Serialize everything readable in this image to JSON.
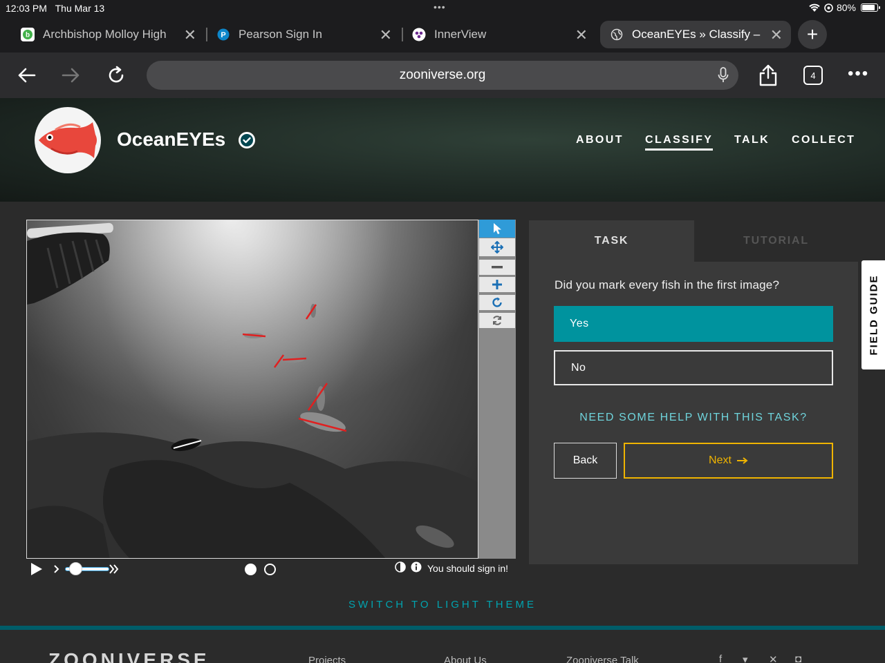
{
  "status": {
    "time": "12:03 PM",
    "date": "Thu Mar 13",
    "dots": "•••",
    "battery": "80%",
    "battery_level": 0.8
  },
  "tabs": [
    {
      "title": "Archbishop Molloy High",
      "favicon": "bb-icon",
      "active": false
    },
    {
      "title": "Pearson Sign In",
      "favicon": "pearson-icon",
      "active": false
    },
    {
      "title": "InnerView",
      "favicon": "innerview-icon",
      "active": false
    },
    {
      "title": "OceanEYEs » Classify –",
      "favicon": "globe-icon",
      "active": true
    }
  ],
  "toolbar": {
    "url": "zooniverse.org",
    "tab_count": "4"
  },
  "project": {
    "title": "OceanEYEs",
    "nav": [
      {
        "label": "ABOUT",
        "active": false
      },
      {
        "label": "CLASSIFY",
        "active": true
      },
      {
        "label": "TALK",
        "active": false
      },
      {
        "label": "COLLECT",
        "active": false
      }
    ]
  },
  "viewer": {
    "signin_msg": "You should sign in!",
    "frame_count": 2,
    "current_frame": 1
  },
  "task": {
    "tab_task": "TASK",
    "tab_tutorial": "TUTORIAL",
    "question": "Did you mark every fish in the first image?",
    "answers": [
      "Yes",
      "No"
    ],
    "help": "NEED SOME HELP WITH THIS TASK?",
    "back": "Back",
    "next": "Next"
  },
  "field_guide": "FIELD GUIDE",
  "theme_switch": "SWITCH TO LIGHT THEME",
  "footer": {
    "logo": "ZOONIVERSE",
    "links": [
      "Projects",
      "About Us",
      "Zooniverse Talk"
    ]
  },
  "colors": {
    "accent_teal": "#00939e",
    "next_gold": "#f0b400",
    "tool_blue": "#2f9bd8"
  }
}
